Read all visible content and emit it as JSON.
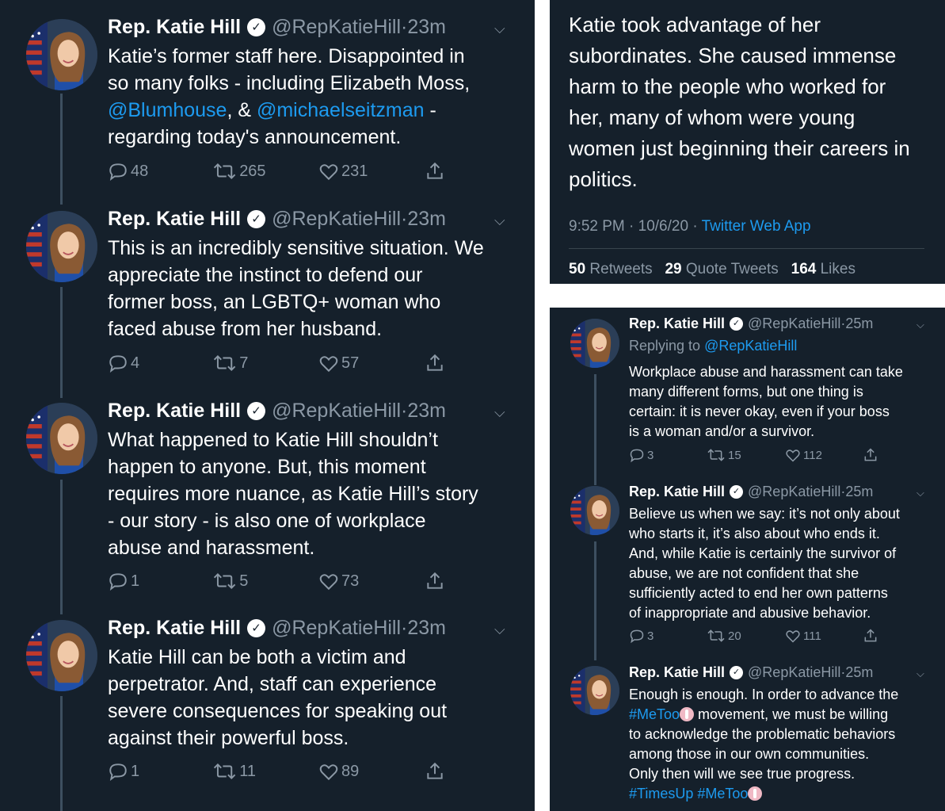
{
  "colors": {
    "background": "#15202b",
    "text": "#ffffff",
    "muted": "#8b98a5",
    "link": "#1d9bf0"
  },
  "account": {
    "name": "Rep. Katie Hill",
    "handle": "@RepKatieHill",
    "verified_icon": "verified-badge-icon"
  },
  "left_tweets": [
    {
      "time": "23m",
      "lines": [
        "Katie’s former staff here. Disappointed in",
        "so many folks - including Elizabeth Moss,"
      ],
      "mention1": "@Blumhouse",
      "mid": ", & ",
      "mention2": "@michaelseitzman",
      "tail": " -",
      "last": "regarding today's announcement.",
      "replies": "48",
      "retweets": "265",
      "likes": "231"
    },
    {
      "time": "23m",
      "lines": [
        "This is an incredibly sensitive situation. We",
        "appreciate the instinct to defend our",
        "former boss, an LGBTQ+ woman who",
        "faced abuse from her husband."
      ],
      "replies": "4",
      "retweets": "7",
      "likes": "57"
    },
    {
      "time": "23m",
      "lines": [
        "What happened to Katie Hill shouldn’t",
        "happen to anyone. But, this moment",
        "requires more nuance, as Katie Hill’s story",
        "- our story - is also one of workplace",
        "abuse and harassment."
      ],
      "replies": "1",
      "retweets": "5",
      "likes": "73"
    },
    {
      "time": "23m",
      "lines": [
        "Katie Hill can be both a victim and",
        "perpetrator. And, staff can experience",
        "severe consequences for speaking out",
        "against their powerful boss."
      ],
      "replies": "1",
      "retweets": "11",
      "likes": "89"
    }
  ],
  "detail": {
    "lines": [
      "Katie took advantage of her",
      "subordinates. She caused immense",
      "harm to the people who worked for",
      "her, many of whom were young",
      "women just beginning their careers in",
      "politics."
    ],
    "timestamp": "9:52 PM · 10/6/20 · ",
    "source": "Twitter Web App",
    "retweets": "50",
    "retweets_label": "Retweets",
    "quotes": "29",
    "quotes_label": "Quote Tweets",
    "likes": "164",
    "likes_label": "Likes"
  },
  "right_tweets": [
    {
      "time": "25m",
      "replying_label": "Replying to ",
      "replying_to": "@RepKatieHill",
      "lines": [
        "Workplace abuse and harassment can take",
        "many different forms, but one thing is",
        "certain: it is never okay, even if your boss",
        "is a woman and/or a survivor."
      ],
      "replies": "3",
      "retweets": "15",
      "likes": "112"
    },
    {
      "time": "25m",
      "lines": [
        "Believe us when we say: it’s not only about",
        "who starts it, it’s also about who ends it.",
        "And, while Katie is certainly the survivor of",
        "abuse, we are not confident that she",
        "sufficiently acted to end her own patterns",
        "of inappropriate and abusive behavior."
      ],
      "replies": "3",
      "retweets": "20",
      "likes": "111"
    },
    {
      "time": "25m",
      "line1": "Enough is enough. In order to advance the",
      "hashtag1": "#MeToo",
      "line2_rest": " movement, we must be willing",
      "lines": [
        "to acknowledge the problematic behaviors",
        "among those in our own communities.",
        "Only then will we see true progress."
      ],
      "hashtag2": "#TimesUp",
      "hashtag3": "#MeToo"
    }
  ]
}
